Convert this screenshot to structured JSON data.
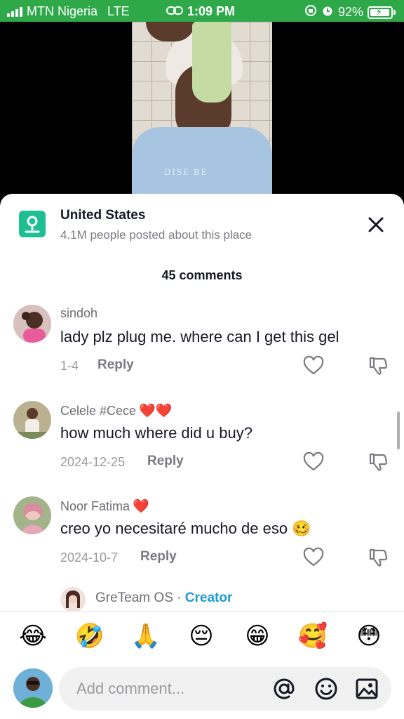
{
  "status_bar": {
    "carrier": "MTN Nigeria",
    "network": "LTE",
    "time": "1:09 PM",
    "battery_percent": "92%",
    "background_color": "#2fa84a"
  },
  "video": {
    "shirt_text": "DISE BE"
  },
  "place": {
    "title": "United States",
    "subtitle": "4.1M people posted about this place",
    "icon": "location-pin-icon"
  },
  "comments_header": {
    "count_label": "45 comments"
  },
  "comments": [
    {
      "username": "sindoh",
      "text": "lady plz plug me. where can I get this gel",
      "date": "1-4",
      "reply_label": "Reply",
      "badge": ""
    },
    {
      "username": "Celele #Cece",
      "text": "how much where did u buy?",
      "date": "2024-12-25",
      "reply_label": "Reply",
      "badge": "❤️❤️"
    },
    {
      "username": "Noor Fatima",
      "text": "creo yo necesitaré mucho de eso",
      "text_emoji": "🥴",
      "date": "2024-10-7",
      "reply_label": "Reply",
      "badge": "❤️"
    }
  ],
  "reply_preview": {
    "username": "GreTeam OS",
    "separator": "·",
    "role": "Creator"
  },
  "emoji_bar": [
    "😂",
    "🤣",
    "🙏",
    "😔",
    "😁",
    "🥰",
    "😳"
  ],
  "comment_input": {
    "placeholder": "Add comment..."
  },
  "colors": {
    "accent_creator": "#1d9bd1",
    "place_icon_bg": "#1fbf94",
    "heart": "#fe2c55"
  }
}
